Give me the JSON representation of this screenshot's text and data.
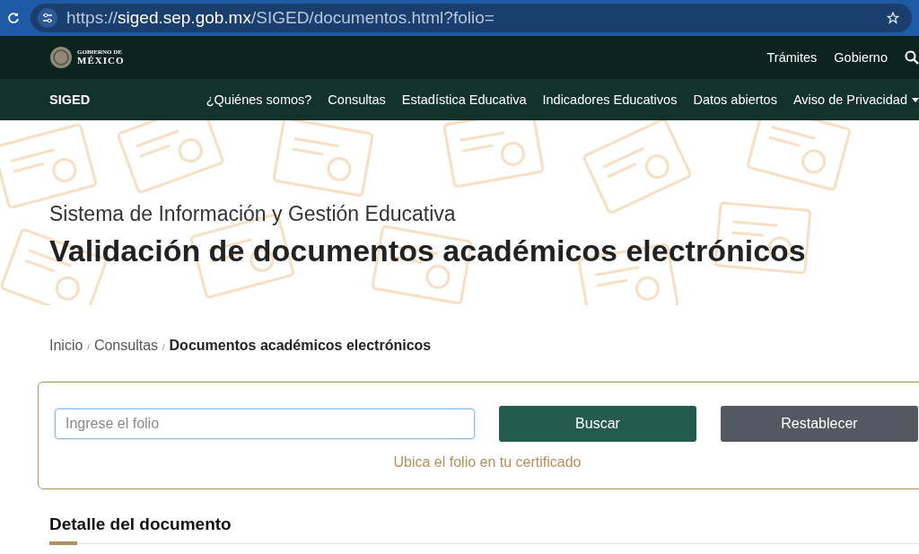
{
  "browser": {
    "url": "https://**siged.sep.gob.mx**/SIGED/documentos.html?folio="
  },
  "gov_bar": {
    "logo_top": "GOBIERNO DE",
    "logo_bottom": "MÉXICO",
    "links": [
      "Trámites",
      "Gobierno"
    ]
  },
  "nav": {
    "brand": "SIGED",
    "items": [
      {
        "label": "¿Quiénes somos?",
        "dropdown": false
      },
      {
        "label": "Consultas",
        "dropdown": false
      },
      {
        "label": "Estadística Educativa",
        "dropdown": false
      },
      {
        "label": "Indicadores Educativos",
        "dropdown": false
      },
      {
        "label": "Datos abiertos",
        "dropdown": false
      },
      {
        "label": "Aviso de Privacidad",
        "dropdown": true
      }
    ]
  },
  "hero": {
    "subtitle": "Sistema de Información y Gestión Educativa",
    "title": "Validación de documentos académicos electrónicos"
  },
  "breadcrumb_separator": "/",
  "breadcrumb": [
    {
      "label": "Inicio",
      "current": false
    },
    {
      "label": "Consultas",
      "current": false
    },
    {
      "label": "Documentos académicos electrónicos",
      "current": true
    }
  ],
  "search_form": {
    "placeholder": "Ingrese el folio",
    "buttons": [
      {
        "label": "Buscar",
        "kind": "primary"
      },
      {
        "label": "Restablecer",
        "kind": "secondary"
      }
    ],
    "hint": "Ubica el folio en tu certificado"
  },
  "section": {
    "title": "Detalle del documento"
  }
}
